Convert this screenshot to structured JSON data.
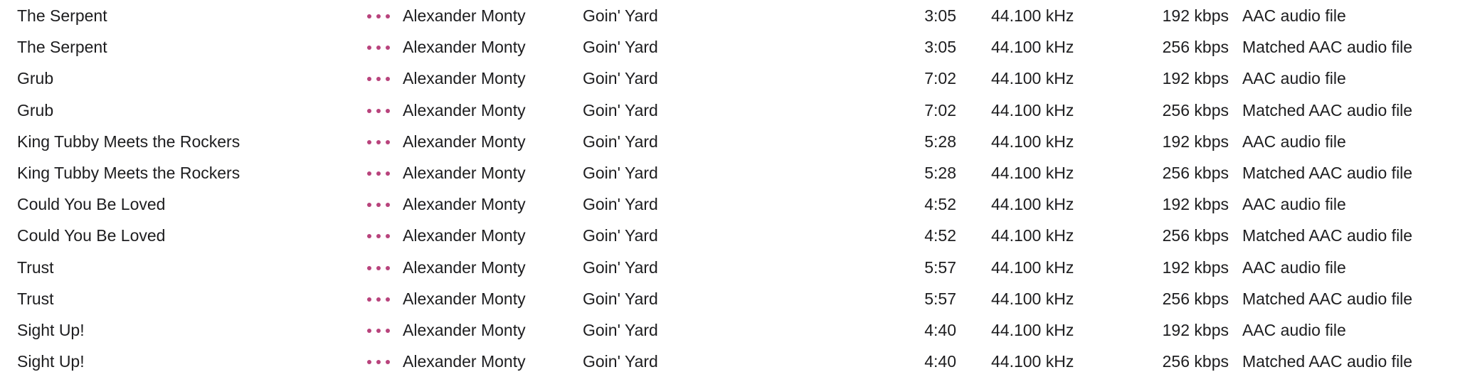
{
  "accent_color": "#b8437c",
  "rows": [
    {
      "title": "The Serpent",
      "artist": "Alexander Monty",
      "album": "Goin' Yard",
      "time": "3:05",
      "sample_rate": "44.100 kHz",
      "bit_rate": "192 kbps",
      "kind": "AAC audio file"
    },
    {
      "title": "The Serpent",
      "artist": "Alexander Monty",
      "album": "Goin' Yard",
      "time": "3:05",
      "sample_rate": "44.100 kHz",
      "bit_rate": "256 kbps",
      "kind": "Matched AAC audio file"
    },
    {
      "title": "Grub",
      "artist": "Alexander Monty",
      "album": "Goin' Yard",
      "time": "7:02",
      "sample_rate": "44.100 kHz",
      "bit_rate": "192 kbps",
      "kind": "AAC audio file"
    },
    {
      "title": "Grub",
      "artist": "Alexander Monty",
      "album": "Goin' Yard",
      "time": "7:02",
      "sample_rate": "44.100 kHz",
      "bit_rate": "256 kbps",
      "kind": "Matched AAC audio file"
    },
    {
      "title": "King Tubby Meets the Rockers",
      "artist": "Alexander Monty",
      "album": "Goin' Yard",
      "time": "5:28",
      "sample_rate": "44.100 kHz",
      "bit_rate": "192 kbps",
      "kind": "AAC audio file"
    },
    {
      "title": "King Tubby Meets the Rockers",
      "artist": "Alexander Monty",
      "album": "Goin' Yard",
      "time": "5:28",
      "sample_rate": "44.100 kHz",
      "bit_rate": "256 kbps",
      "kind": "Matched AAC audio file"
    },
    {
      "title": "Could You Be Loved",
      "artist": "Alexander Monty",
      "album": "Goin' Yard",
      "time": "4:52",
      "sample_rate": "44.100 kHz",
      "bit_rate": "192 kbps",
      "kind": "AAC audio file"
    },
    {
      "title": "Could You Be Loved",
      "artist": "Alexander Monty",
      "album": "Goin' Yard",
      "time": "4:52",
      "sample_rate": "44.100 kHz",
      "bit_rate": "256 kbps",
      "kind": "Matched AAC audio file"
    },
    {
      "title": "Trust",
      "artist": "Alexander Monty",
      "album": "Goin' Yard",
      "time": "5:57",
      "sample_rate": "44.100 kHz",
      "bit_rate": "192 kbps",
      "kind": "AAC audio file"
    },
    {
      "title": "Trust",
      "artist": "Alexander Monty",
      "album": "Goin' Yard",
      "time": "5:57",
      "sample_rate": "44.100 kHz",
      "bit_rate": "256 kbps",
      "kind": "Matched AAC audio file"
    },
    {
      "title": "Sight Up!",
      "artist": "Alexander Monty",
      "album": "Goin' Yard",
      "time": "4:40",
      "sample_rate": "44.100 kHz",
      "bit_rate": "192 kbps",
      "kind": "AAC audio file"
    },
    {
      "title": "Sight Up!",
      "artist": "Alexander Monty",
      "album": "Goin' Yard",
      "time": "4:40",
      "sample_rate": "44.100 kHz",
      "bit_rate": "256 kbps",
      "kind": "Matched AAC audio file"
    }
  ]
}
